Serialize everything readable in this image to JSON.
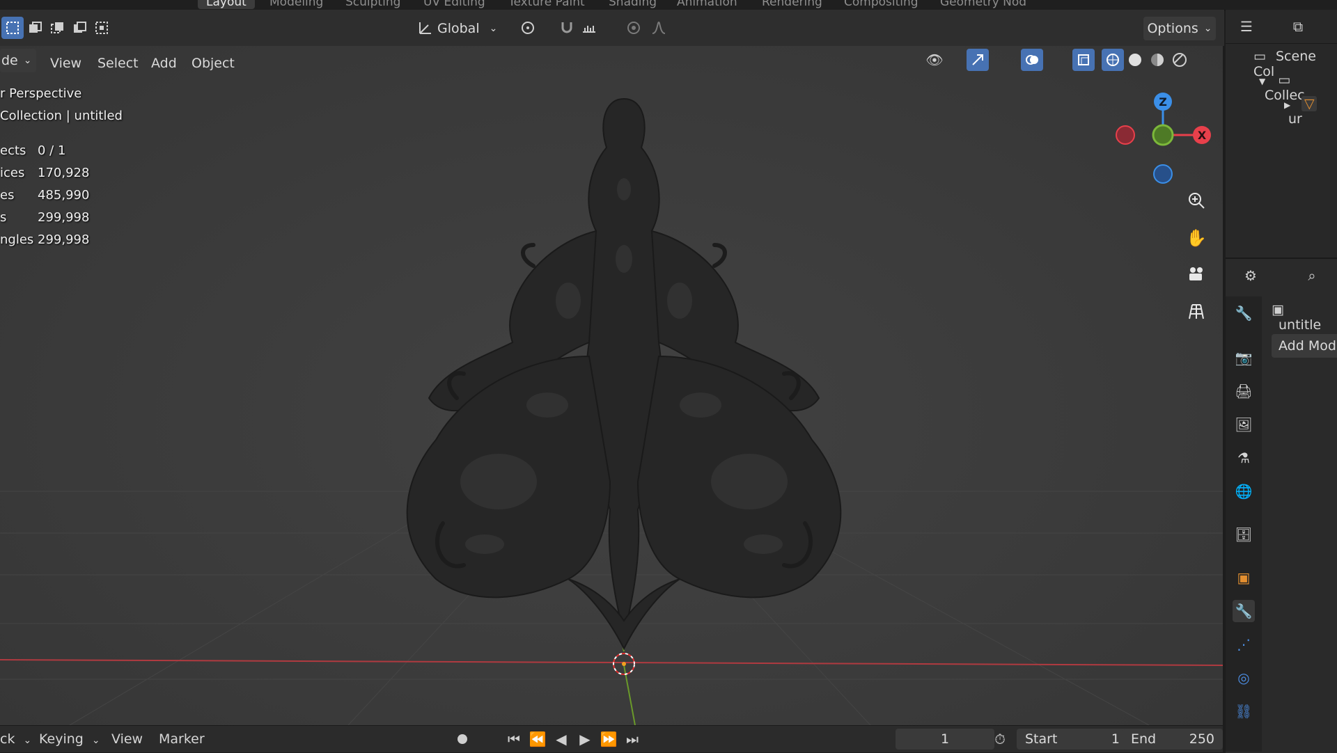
{
  "workspace_tabs": [
    "Layout",
    "Modeling",
    "Sculpting",
    "UV Editing",
    "Texture Paint",
    "Shading",
    "Animation",
    "Rendering",
    "Compositing",
    "Geometry Nod"
  ],
  "toolbar": {
    "transform_orientation": "Global",
    "options_label": "Options"
  },
  "viewport_header": {
    "mode_label": "de",
    "menus": [
      "View",
      "Select",
      "Add",
      "Object"
    ]
  },
  "viewport_info": {
    "view_name": "r Perspective",
    "collection": "Collection | untitled",
    "stats": [
      {
        "label": "ects",
        "value": "0 / 1"
      },
      {
        "label": "ices",
        "value": "170,928"
      },
      {
        "label": "es",
        "value": "485,990"
      },
      {
        "label": "s",
        "value": "299,998"
      },
      {
        "label": "ngles",
        "value": "299,998"
      }
    ]
  },
  "gizmo": {
    "z": "Z",
    "x": "X"
  },
  "timeline": {
    "mode_label": "ck",
    "keying_label": "Keying",
    "view_label": "View",
    "marker_label": "Marker",
    "current_frame": "1",
    "start_label": "Start",
    "start_value": "1",
    "end_label": "End",
    "end_value": "250"
  },
  "outliner": {
    "scene_label": "Scene Col",
    "collection_label": "Collec",
    "object_label": "ur"
  },
  "properties": {
    "object_name": "untitle",
    "add_modifier": "Add Modif"
  },
  "colors": {
    "accent_blue": "#4772b3",
    "x_axis": "#e8404b",
    "y_axis": "#7cb83a",
    "z_axis": "#3b8fe8",
    "wrench": "#4d8fe6",
    "object_orange": "#e38f30"
  }
}
